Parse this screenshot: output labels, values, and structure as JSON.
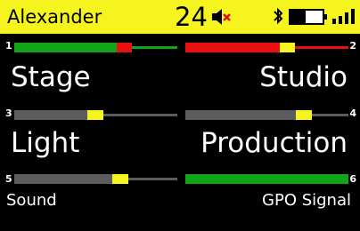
{
  "header": {
    "user_name": "Alexander",
    "channel_number": "24",
    "icons": [
      "speaker-muted-icon",
      "bluetooth-icon",
      "battery-icon",
      "signal-strength-icon"
    ]
  },
  "colors": {
    "topbar": "#F6F41F",
    "green": "#11A51A",
    "red": "#E81010",
    "gray": "#5A5C5E",
    "yellow": "#F6F41F",
    "text": "#FFFFFF"
  },
  "channels": [
    {
      "number": "1",
      "label": "Stage",
      "status": "talking",
      "level": 0.64
    },
    {
      "number": "2",
      "label": "Studio",
      "status": "called",
      "level": 0.55
    },
    {
      "number": "3",
      "label": "Light",
      "status": "idle",
      "level": 0.43
    },
    {
      "number": "4",
      "label": "Production",
      "status": "idle",
      "level": 0.63
    },
    {
      "number": "5",
      "label": "Sound",
      "status": "idle",
      "level": 0.58
    },
    {
      "number": "6",
      "label": "GPO Signal",
      "status": "active",
      "level": 1.0
    }
  ]
}
